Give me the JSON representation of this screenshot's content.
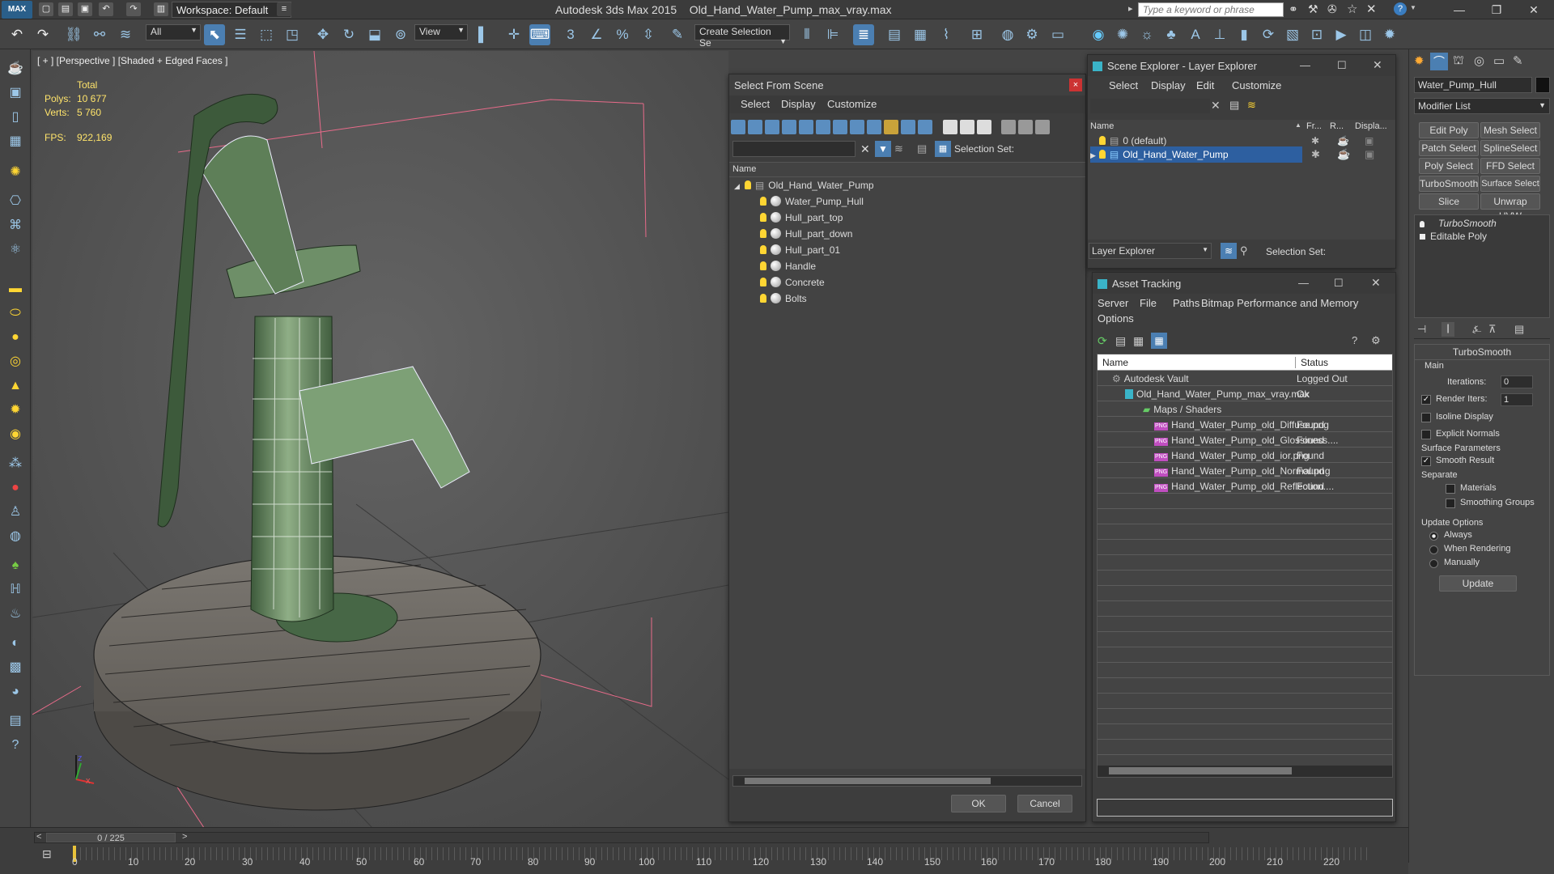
{
  "app": {
    "title_app": "Autodesk 3ds Max  2015",
    "title_file": "Old_Hand_Water_Pump_max_vray.max",
    "workspace": "Workspace: Default",
    "search_placeholder": "Type a keyword or phrase",
    "max_logo": "MAX"
  },
  "toolbar": {
    "selection_filter": "All",
    "ref_coord": "View",
    "named_selection": "Create Selection Se",
    "snap_label": "3",
    "percent_label": "%"
  },
  "viewport": {
    "label": "[ + ] [Perspective ] [Shaded + Edged Faces ]",
    "stats_total": "Total",
    "polys_label": "Polys:",
    "polys_value": "10 677",
    "verts_label": "Verts:",
    "verts_value": "5 760",
    "fps_label": "FPS:",
    "fps_value": "922,169",
    "axis_x": "x",
    "axis_z": "z"
  },
  "select_from_scene": {
    "title": "Select From Scene",
    "menu": [
      "Select",
      "Display",
      "Customize"
    ],
    "selection_set_label": "Selection Set:",
    "column_name": "Name",
    "root": "Old_Hand_Water_Pump",
    "children": [
      "Water_Pump_Hull",
      "Hull_part_top",
      "Hull_part_down",
      "Hull_part_01",
      "Handle",
      "Concrete",
      "Bolts"
    ],
    "ok": "OK",
    "cancel": "Cancel"
  },
  "scene_explorer": {
    "title": "Scene Explorer - Layer Explorer",
    "menu": [
      "Select",
      "Display",
      "Edit",
      "Customize"
    ],
    "columns": [
      "Name",
      "Fr...",
      "R...",
      "Displa..."
    ],
    "layers": [
      "0 (default)",
      "Old_Hand_Water_Pump"
    ],
    "footer_combo": "Layer Explorer",
    "selection_set_label": "Selection Set:"
  },
  "asset_tracking": {
    "title": "Asset Tracking",
    "menu": [
      "Server",
      "File",
      "Paths",
      "Bitmap Performance and Memory",
      "Options"
    ],
    "columns": [
      "Name",
      "Status"
    ],
    "rows": [
      {
        "name": "Autodesk Vault",
        "status": "Logged Out"
      },
      {
        "name": "Old_Hand_Water_Pump_max_vray.max",
        "status": "Ok"
      },
      {
        "name": "Maps / Shaders",
        "status": ""
      },
      {
        "name": "Hand_Water_Pump_old_Diffuse.png",
        "status": "Found"
      },
      {
        "name": "Hand_Water_Pump_old_Glossiness....",
        "status": "Found"
      },
      {
        "name": "Hand_Water_Pump_old_ior.png",
        "status": "Found"
      },
      {
        "name": "Hand_Water_Pump_old_Normal.png",
        "status": "Found"
      },
      {
        "name": "Hand_Water_Pump_old_Reflection....",
        "status": "Found"
      }
    ],
    "png_badge": "PNG"
  },
  "command_panel": {
    "object_name": "Water_Pump_Hull",
    "modifier_list": "Modifier List",
    "buttons": [
      "Edit Poly",
      "Mesh Select",
      "Patch Select",
      "SplineSelect",
      "Poly Select",
      "FFD Select",
      "TurboSmooth",
      "Surface Select",
      "Slice",
      "Unwrap UVW"
    ],
    "stack": [
      "TurboSmooth",
      "Editable Poly"
    ],
    "rollout_title": "TurboSmooth",
    "main_label": "Main",
    "iterations_label": "Iterations:",
    "iterations_value": "0",
    "render_iters_label": "Render Iters:",
    "render_iters_value": "1",
    "isoline": "Isoline Display",
    "explicit_normals": "Explicit Normals",
    "surface_params": "Surface Parameters",
    "smooth_result": "Smooth Result",
    "separate": "Separate",
    "materials": "Materials",
    "smoothing_groups": "Smoothing Groups",
    "update_options": "Update Options",
    "always": "Always",
    "when_rendering": "When Rendering",
    "manually": "Manually",
    "update": "Update"
  },
  "timeline": {
    "frame": "0 / 225",
    "ticks": [
      "0",
      "10",
      "20",
      "30",
      "40",
      "50",
      "60",
      "70",
      "80",
      "90",
      "100",
      "110",
      "120",
      "130",
      "140",
      "150",
      "160",
      "170",
      "180",
      "190",
      "200",
      "210",
      "220"
    ]
  }
}
